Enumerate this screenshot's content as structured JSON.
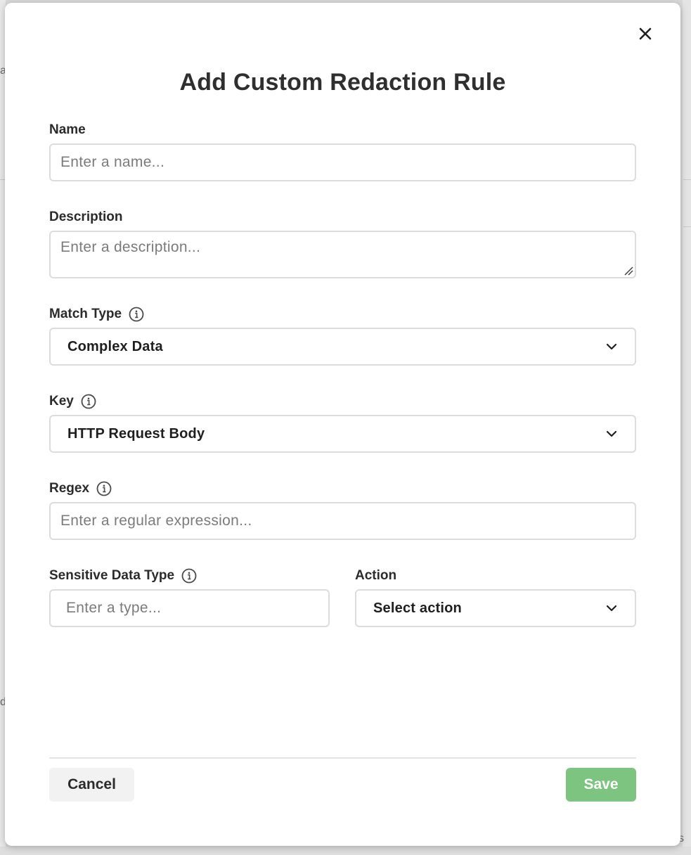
{
  "modal": {
    "title": "Add Custom Redaction Rule",
    "close_icon": "close-icon"
  },
  "fields": {
    "name": {
      "label": "Name",
      "placeholder": "Enter a name..."
    },
    "description": {
      "label": "Description",
      "placeholder": "Enter a description..."
    },
    "match_type": {
      "label": "Match Type",
      "value": "Complex Data",
      "info_icon": "info-icon"
    },
    "key": {
      "label": "Key",
      "value": "HTTP Request Body",
      "info_icon": "info-icon"
    },
    "regex": {
      "label": "Regex",
      "placeholder": "Enter a regular expression...",
      "info_icon": "info-icon"
    },
    "sensitive_data_type": {
      "label": "Sensitive Data Type",
      "placeholder": "Enter a type...",
      "info_icon": "info-icon"
    },
    "action": {
      "label": "Action",
      "value": "Select action"
    }
  },
  "footer": {
    "cancel_label": "Cancel",
    "save_label": "Save"
  },
  "colors": {
    "save_button": "#7cc47f",
    "cancel_button": "#f1f2f1",
    "border": "#dcdcdc"
  },
  "background": {
    "glyphs": [
      "a",
      "d",
      "s"
    ]
  }
}
